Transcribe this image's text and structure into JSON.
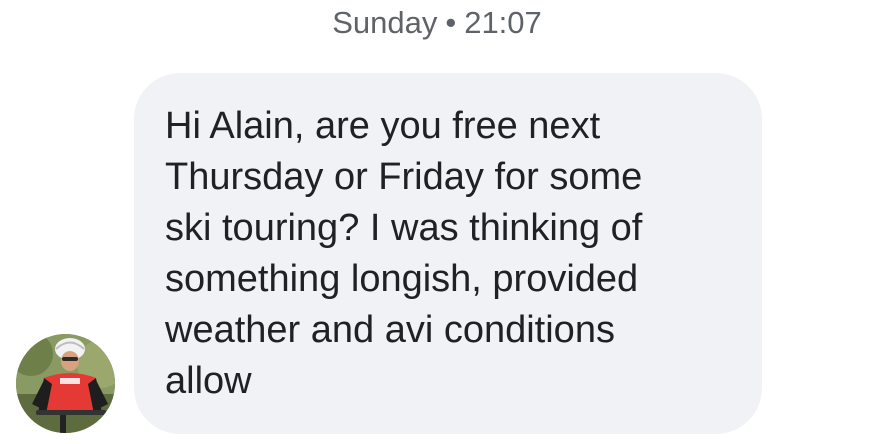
{
  "conversation": {
    "timestamp": {
      "day": "Sunday",
      "separator": "•",
      "time": "21:07"
    },
    "message": {
      "lines": [
        "Hi Alain, are you free next",
        "Thursday or Friday for some",
        "ski touring? I was thinking of",
        "something longish, provided",
        "weather and avi conditions",
        "allow"
      ]
    },
    "sender": {
      "avatar_icon": "cyclist-photo-avatar"
    }
  },
  "colors": {
    "background": "#ffffff",
    "bubble": "#f1f2f5",
    "message_text": "#202124",
    "timestamp_text": "#5f6368"
  }
}
